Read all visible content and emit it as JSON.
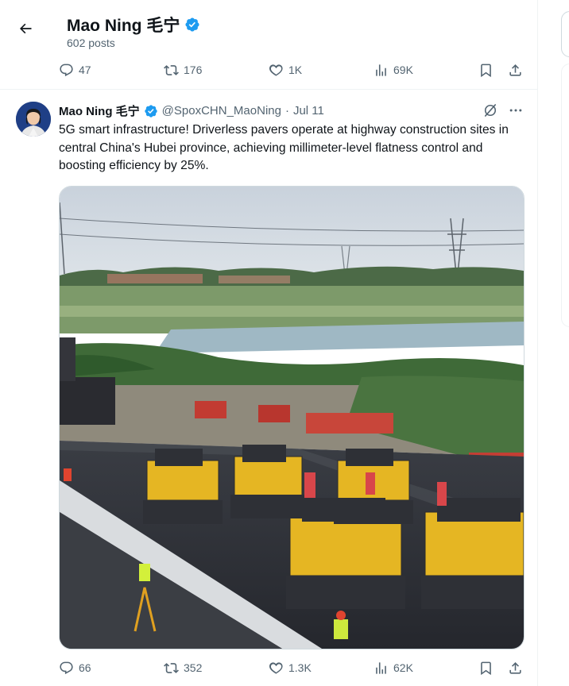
{
  "profile_header": {
    "name": "Mao Ning 毛宁",
    "post_count": "602 posts"
  },
  "prev_tweet_actions": {
    "replies": "47",
    "reposts": "176",
    "likes": "1K",
    "views": "69K"
  },
  "tweet": {
    "author_name": "Mao Ning 毛宁",
    "handle": "@SpoxCHN_MaoNing",
    "separator": "·",
    "date": "Jul 11",
    "text": "5G smart infrastructure! Driverless pavers operate at highway construction sites in central China's Hubei province, achieving millimeter-level flatness control and boosting efficiency by 25%.",
    "actions": {
      "replies": "66",
      "reposts": "352",
      "likes": "1.3K",
      "views": "62K"
    }
  },
  "colors": {
    "accent": "#1d9bf0",
    "text_primary": "#0f1419",
    "text_secondary": "#536471",
    "border": "#eff3f4"
  },
  "icons": [
    "back-arrow-icon",
    "verified-badge-icon",
    "reply-icon",
    "repost-icon",
    "like-icon",
    "views-icon",
    "bookmark-icon",
    "share-icon",
    "grok-icon",
    "more-icon"
  ]
}
